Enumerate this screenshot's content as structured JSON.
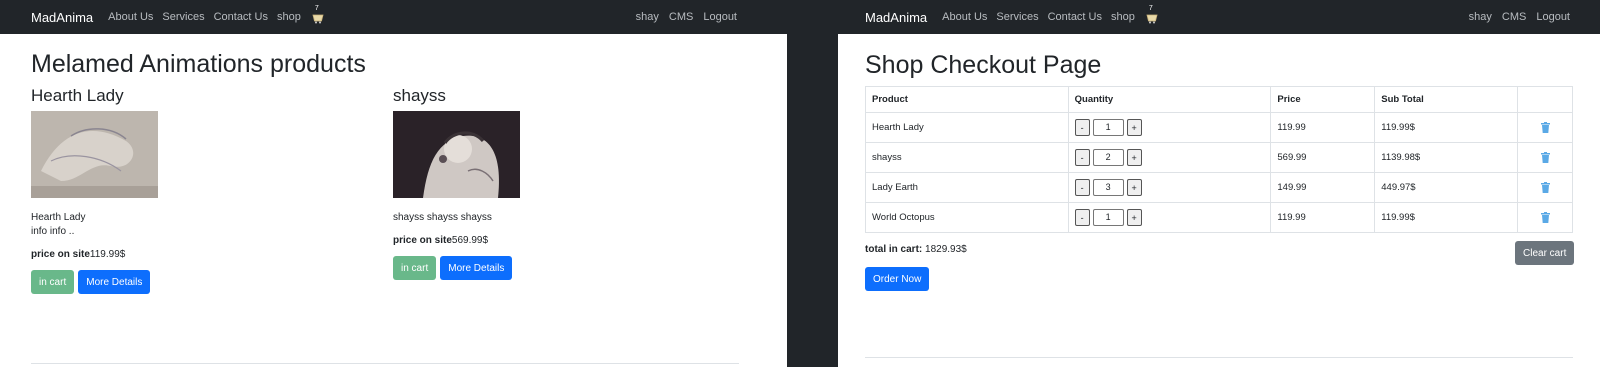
{
  "nav": {
    "brand": "MadAnima",
    "links": [
      "About Us",
      "Services",
      "Contact Us",
      "shop"
    ],
    "cart_count": "7",
    "right_links": [
      "shay",
      "CMS",
      "Logout"
    ]
  },
  "products_page": {
    "title": "Melamed Animations products",
    "products": [
      {
        "name": "Hearth Lady",
        "description": "Hearth Lady\ninfo info ..",
        "price_label": "price on site",
        "price": "119.99$",
        "cart_button": "in cart",
        "details_button": "More Details"
      },
      {
        "name": "shayss",
        "description": "shayss shayss shayss",
        "price_label": "price on site",
        "price": "569.99$",
        "cart_button": "in cart",
        "details_button": "More Details"
      }
    ]
  },
  "checkout_page": {
    "title": "Shop Checkout Page",
    "columns": [
      "Product",
      "Quantity",
      "Price",
      "Sub Total",
      ""
    ],
    "rows": [
      {
        "product": "Hearth Lady",
        "quantity": "1",
        "price": "119.99",
        "subtotal": "119.99$"
      },
      {
        "product": "shayss",
        "quantity": "2",
        "price": "569.99",
        "subtotal": "1139.98$"
      },
      {
        "product": "Lady Earth",
        "quantity": "3",
        "price": "149.99",
        "subtotal": "449.97$"
      },
      {
        "product": "World Octopus",
        "quantity": "1",
        "price": "119.99",
        "subtotal": "119.99$"
      }
    ],
    "minus": "-",
    "plus": "+",
    "total_label": "total in cart:",
    "total_value": "1829.93$",
    "clear_button": "Clear cart",
    "order_button": "Order Now"
  },
  "colors": {
    "navbar": "#212529",
    "in_cart": "#69b88a",
    "primary": "#0d6efd",
    "secondary": "#6c757d",
    "trash": "#5aa9e6"
  },
  "icons": [
    "cart-icon",
    "trash-icon"
  ]
}
